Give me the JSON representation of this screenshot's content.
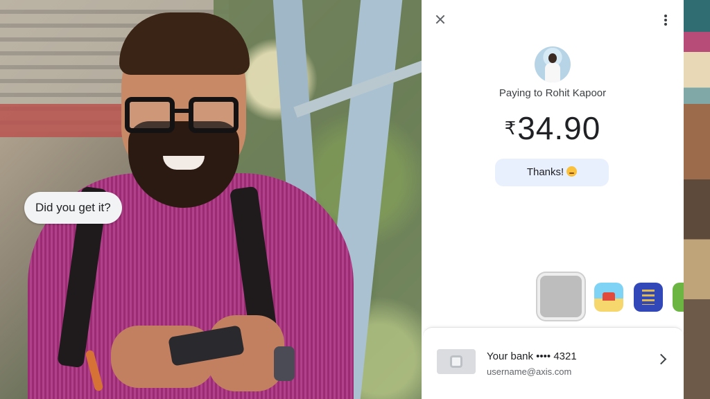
{
  "chat": {
    "message": "Did you get it?"
  },
  "payment": {
    "payee_label": "Paying to Rohit Kapoor",
    "currency_symbol": "₹",
    "amount": "34.90",
    "note": "Thanks!"
  },
  "bank": {
    "name": "Your bank •••• 4321",
    "upi_id": "username@axis.com"
  },
  "icons": {
    "close": "close-icon",
    "more": "more-vert-icon",
    "chevron": "chevron-right-icon",
    "emoji": "smiling-face-icon"
  },
  "colors": {
    "note_bg": "#e8f0fe",
    "text_primary": "#202124",
    "text_secondary": "#5f6368"
  }
}
